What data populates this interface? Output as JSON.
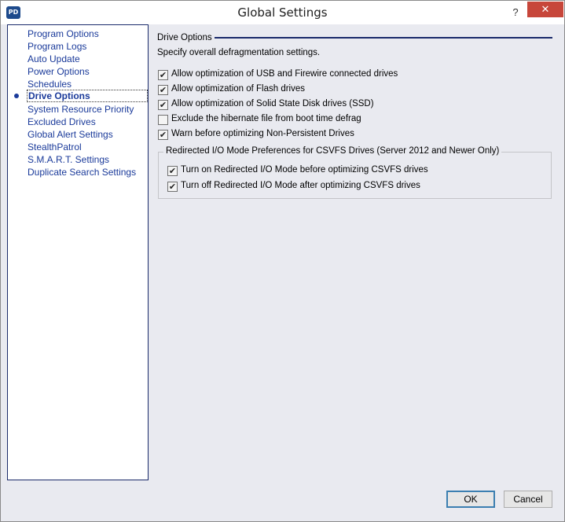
{
  "window": {
    "title": "Global Settings",
    "app_icon_text": "PD",
    "help_label": "?",
    "close_label": "✕"
  },
  "nav": {
    "items": [
      {
        "label": "Program Options"
      },
      {
        "label": "Program Logs"
      },
      {
        "label": "Auto Update"
      },
      {
        "label": "Power Options"
      },
      {
        "label": "Schedules"
      },
      {
        "label": "Drive Options",
        "selected": true
      },
      {
        "label": "System Resource Priority"
      },
      {
        "label": "Excluded Drives"
      },
      {
        "label": "Global Alert Settings"
      },
      {
        "label": "StealthPatrol"
      },
      {
        "label": "S.M.A.R.T. Settings"
      },
      {
        "label": "Duplicate Search Settings"
      }
    ]
  },
  "content": {
    "section_title": "Drive Options",
    "description": "Specify overall defragmentation settings.",
    "options": [
      {
        "label": "Allow optimization of USB and Firewire connected drives",
        "checked": true
      },
      {
        "label": "Allow optimization of Flash drives",
        "checked": true
      },
      {
        "label": "Allow optimization of Solid State Disk drives (SSD)",
        "checked": true
      },
      {
        "label": "Exclude the hibernate file from boot time defrag",
        "checked": false
      },
      {
        "label": "Warn before optimizing Non-Persistent Drives",
        "checked": true
      }
    ],
    "group": {
      "title": "Redirected I/O Mode Preferences for CSVFS Drives (Server 2012 and Newer Only)",
      "options": [
        {
          "label": "Turn on Redirected I/O Mode before optimizing CSVFS drives",
          "checked": true
        },
        {
          "label": "Turn off Redirected I/O Mode after optimizing CSVFS drives",
          "checked": true
        }
      ]
    }
  },
  "buttons": {
    "ok": "OK",
    "cancel": "Cancel"
  },
  "colors": {
    "nav_link": "#1a3a9a",
    "close_button": "#c7463a",
    "panel_border": "#1a2a6a",
    "default_button_border": "#3c7fb1"
  }
}
